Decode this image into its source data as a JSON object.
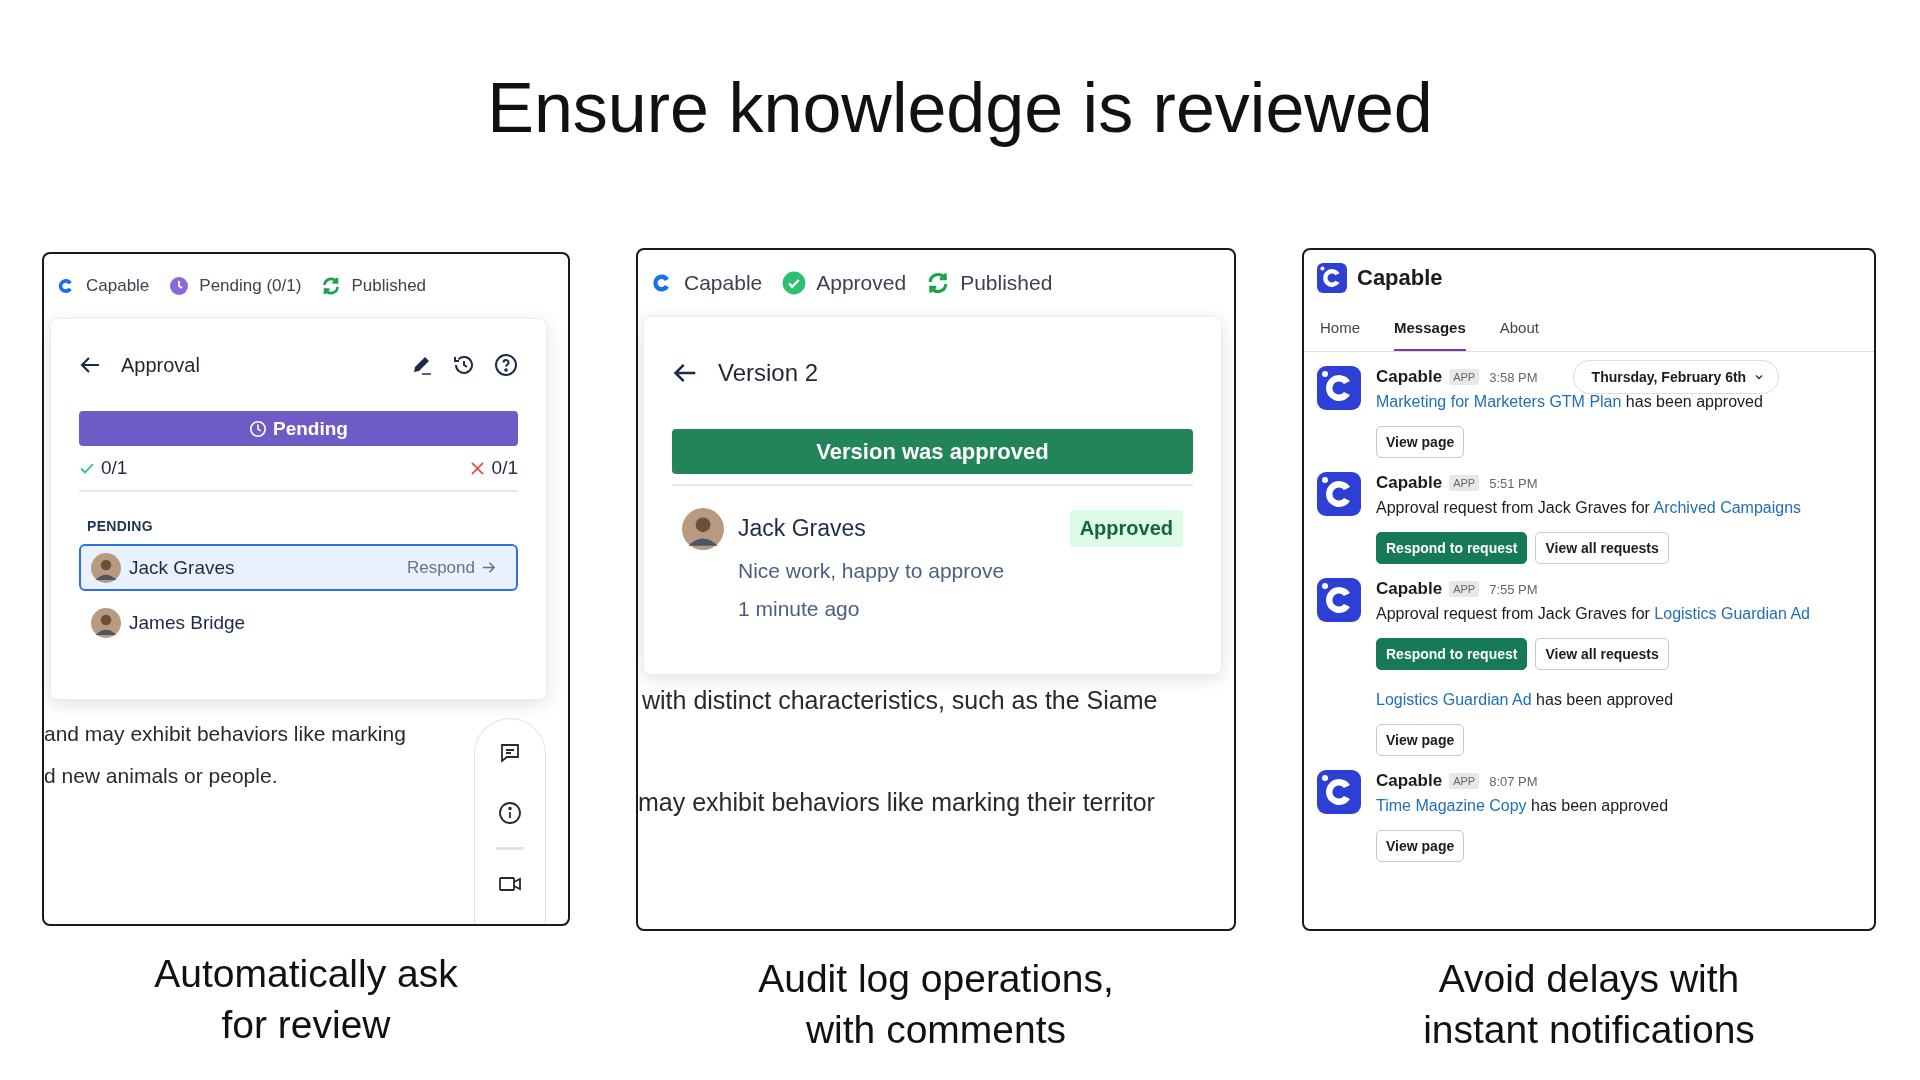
{
  "headline": "Ensure knowledge is reviewed",
  "approval_panel": {
    "status_bar": [
      {
        "kind": "logo",
        "label": "Capable"
      },
      {
        "kind": "pending",
        "label": "Pending (0/1)"
      },
      {
        "kind": "published",
        "label": "Published"
      }
    ],
    "popover": {
      "title": "Approval",
      "status": "Pending",
      "approved_count": "0/1",
      "rejected_count": "0/1",
      "section": "PENDING",
      "reviewers": [
        {
          "name": "Jack Graves",
          "selected": true,
          "action": "Respond"
        },
        {
          "name": "James Bridge",
          "selected": false
        }
      ]
    },
    "body_lines": [
      "and may exhibit behaviors like marking",
      "d new animals or people."
    ],
    "caption": [
      "Automatically ask",
      "for review"
    ]
  },
  "version_panel": {
    "status_bar": [
      {
        "kind": "logo",
        "label": "Capable"
      },
      {
        "kind": "approved",
        "label": "Approved"
      },
      {
        "kind": "published",
        "label": "Published"
      }
    ],
    "popover": {
      "title": "Version 2",
      "banner": "Version was approved",
      "reviewer": "Jack Graves",
      "badge": "Approved",
      "comment": "Nice work, happy to approve",
      "time": "1 minute ago"
    },
    "body_lines": [
      "with distinct characteristics, such as the Siame",
      "may exhibit behaviors like marking their territor"
    ],
    "caption": [
      "Audit log operations,",
      "with comments"
    ]
  },
  "messages_panel": {
    "app_name": "Capable",
    "tabs": [
      {
        "label": "Home",
        "selected": false
      },
      {
        "label": "Messages",
        "selected": true
      },
      {
        "label": "About",
        "selected": false
      }
    ],
    "messages": [
      {
        "kind": "full",
        "sender": "Capable",
        "badge": "APP",
        "time": "3:58 PM",
        "date_pill": "Thursday, February 6th",
        "parts": [
          {
            "text": "Marketing for Marketers GTM Plan",
            "link": true
          },
          {
            "text": " has been approved",
            "link": false
          }
        ],
        "buttons": [
          {
            "label": "View page",
            "kind": "secondary"
          }
        ]
      },
      {
        "kind": "full",
        "sender": "Capable",
        "badge": "APP",
        "time": "5:51 PM",
        "parts": [
          {
            "text": "Approval request from Jack Graves for ",
            "link": false
          },
          {
            "text": "Archived Campaigns",
            "link": true
          }
        ],
        "buttons": [
          {
            "label": "Respond to request",
            "kind": "primary"
          },
          {
            "label": "View all requests",
            "kind": "secondary"
          }
        ]
      },
      {
        "kind": "full",
        "sender": "Capable",
        "badge": "APP",
        "time": "7:55 PM",
        "parts": [
          {
            "text": "Approval request from Jack Graves for ",
            "link": false
          },
          {
            "text": "Logistics Guardian Ad",
            "link": true
          }
        ],
        "buttons": [
          {
            "label": "Respond to request",
            "kind": "primary"
          },
          {
            "label": "View all requests",
            "kind": "secondary"
          }
        ]
      },
      {
        "kind": "continuation",
        "parts": [
          {
            "text": "Logistics Guardian Ad",
            "link": true
          },
          {
            "text": " has been approved",
            "link": false
          }
        ],
        "buttons": [
          {
            "label": "View page",
            "kind": "secondary"
          }
        ]
      },
      {
        "kind": "full",
        "sender": "Capable",
        "badge": "APP",
        "time": "8:07 PM",
        "parts": [
          {
            "text": "Time Magazine Copy",
            "link": true
          },
          {
            "text": " has been approved",
            "link": false
          }
        ],
        "buttons": [
          {
            "label": "View page",
            "kind": "secondary"
          }
        ]
      }
    ],
    "caption": [
      "Avoid delays with",
      "instant notifications"
    ]
  }
}
